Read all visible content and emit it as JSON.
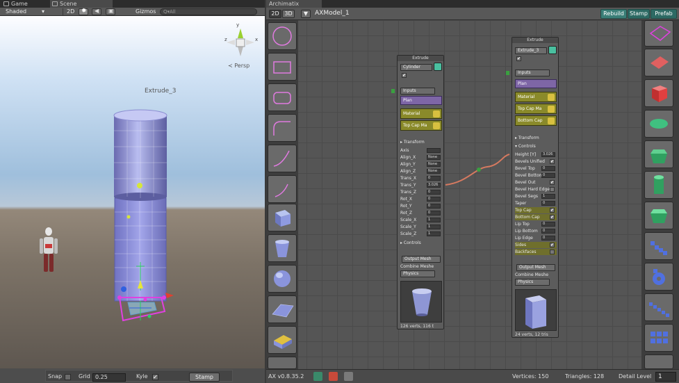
{
  "scene": {
    "tab_game": "Game",
    "tab_scene": "Scene",
    "shading_mode": "Shaded",
    "btn_2d": "2D",
    "gizmos": "Gizmos",
    "search_placeholder": "Q▾All",
    "persp_label": "≺ Persp",
    "object_label": "Extrude_3",
    "bottom": {
      "snap_label": "Snap",
      "grid_label": "Grid",
      "grid_value": "0.25",
      "kyle_label": "Kyle",
      "kyle_checked": "✔",
      "stamp_label": "Stamp"
    }
  },
  "archimatix": {
    "tab_title": "Archimatix",
    "btn_2d": "2D",
    "btn_3d": "3D",
    "model_name": "AXModel_1",
    "rebuild": "Rebuild",
    "stamp": "Stamp",
    "prefab": "Prefab",
    "status": {
      "version": "AX v0.8.35.2",
      "vertices": "Vertices: 150",
      "triangles": "Triangles: 128",
      "detail_label": "Detail Level",
      "detail_value": "1"
    },
    "left_palette": [
      "circle",
      "rectangle",
      "rounded-rect",
      "fillet-corner",
      "arc-curve",
      "small-arc",
      "cube",
      "cup",
      "sphere",
      "grid-plane",
      "bevel-box",
      "stair"
    ],
    "right_palette": [
      "bounding-box",
      "plane",
      "cube",
      "disc",
      "hex-prism",
      "cylinder",
      "hex-column",
      "stairs",
      "spiral",
      "stairs-b",
      "grid-array",
      "cube-b"
    ]
  },
  "node_left": {
    "title": "Extrude",
    "name_value": "Cylinder",
    "check": "✔",
    "inputs_label": "Inputs",
    "plan_label": "Plan",
    "material_label": "Material",
    "topcap_label": "Top Cap Ma",
    "transform_label": "Transform",
    "rows": [
      {
        "label": "Axis",
        "value": ""
      },
      {
        "label": "Align_X",
        "value": "None"
      },
      {
        "label": "Align_Y",
        "value": "None"
      },
      {
        "label": "Align_Z",
        "value": "None"
      },
      {
        "label": "Trans_X",
        "value": "0"
      },
      {
        "label": "Trans_Y",
        "value": "3.026"
      },
      {
        "label": "Trans_Z",
        "value": "0"
      },
      {
        "label": "Rot_X",
        "value": "0"
      },
      {
        "label": "Rot_Y",
        "value": "0"
      },
      {
        "label": "Rot_Z",
        "value": "0"
      },
      {
        "label": "Scale_X",
        "value": "1"
      },
      {
        "label": "Scale_Y",
        "value": "1"
      },
      {
        "label": "Scale_Z",
        "value": "1"
      }
    ],
    "controls_label": "Controls",
    "output_mesh": "Output Mesh",
    "combine_meshes": "Combine Meshe",
    "physics": "Physics",
    "footer": "126 verts, 116 t"
  },
  "node_right": {
    "title": "Extrude",
    "name_value": "Extrude_3",
    "check": "✔",
    "inputs_label": "Inputs",
    "plan_label": "Plan",
    "material_label": "Material",
    "topcap_label": "Top Cap Ma",
    "bottomcap_label": "Bottom Cap",
    "transform_label": "Transform",
    "controls_label": "Controls",
    "rows": [
      {
        "label": "Height [Y]",
        "value": "3.026"
      },
      {
        "label": "Bevels Unified",
        "value": "✔"
      },
      {
        "label": "Bevel Top",
        "value": "0"
      },
      {
        "label": "Bevel Bottom",
        "value": "0"
      },
      {
        "label": "Bevel Out",
        "value": "✔"
      },
      {
        "label": "Bevel Hard Edge",
        "value": ""
      },
      {
        "label": "Bevel Segs",
        "value": "1"
      },
      {
        "label": "Taper",
        "value": "0"
      },
      {
        "label": "Top Cap",
        "value": "✔"
      },
      {
        "label": "Bottom Cap",
        "value": "✔"
      },
      {
        "label": "Lip Top",
        "value": "0"
      },
      {
        "label": "Lip Bottom",
        "value": "0"
      },
      {
        "label": "Lip Edge",
        "value": "0"
      },
      {
        "label": "Sides",
        "value": "✔"
      },
      {
        "label": "Backfaces",
        "value": ""
      }
    ],
    "output_mesh": "Output Mesh",
    "combine_meshes": "Combine Meshe",
    "physics": "Physics",
    "footer": "24 verts, 12 tris"
  },
  "colors": {
    "accent_teal": "#3b7f78",
    "node_yellow": "#8a8a2a",
    "node_purple": "#7e66a6",
    "selection_magenta": "#e040e0",
    "wire": "#d77a60"
  }
}
